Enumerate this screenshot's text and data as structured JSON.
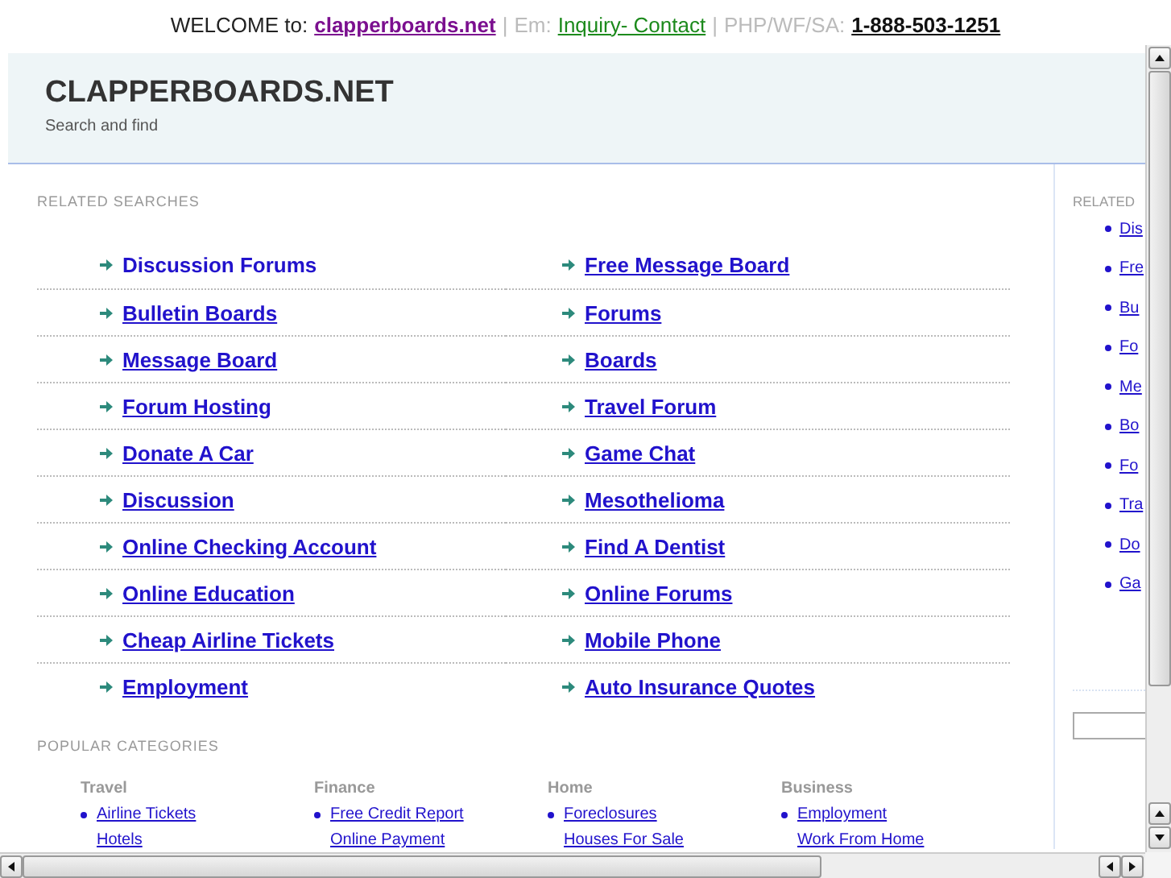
{
  "top_bar": {
    "parts": [
      {
        "kind": "label",
        "text": "WELCOME to:"
      },
      {
        "kind": "site-link",
        "text": "clapperboards.net"
      },
      {
        "kind": "divider",
        "text": "|"
      },
      {
        "kind": "muted",
        "text": "Em:"
      },
      {
        "kind": "contact-link",
        "text": "Inquiry- Contact"
      },
      {
        "kind": "divider",
        "text": "|"
      },
      {
        "kind": "muted",
        "text": "PHP/WF/SA:"
      },
      {
        "kind": "phone",
        "text": "1-888-503-1251"
      }
    ]
  },
  "header": {
    "title": "CLAPPERBOARDS.NET",
    "subtitle": "Search and find"
  },
  "related": {
    "heading": "RELATED SEARCHES",
    "links": [
      {
        "label": "Discussion Forums",
        "hovered": true
      },
      {
        "label": "Free Message Board",
        "hovered": false
      },
      {
        "label": "Bulletin Boards",
        "hovered": false
      },
      {
        "label": "Forums",
        "hovered": false
      },
      {
        "label": "Message Board",
        "hovered": false
      },
      {
        "label": "Boards",
        "hovered": false
      },
      {
        "label": "Forum Hosting",
        "hovered": false
      },
      {
        "label": "Travel Forum",
        "hovered": false
      },
      {
        "label": "Donate A Car",
        "hovered": false
      },
      {
        "label": "Game Chat",
        "hovered": false
      },
      {
        "label": "Discussion",
        "hovered": false
      },
      {
        "label": "Mesothelioma",
        "hovered": false
      },
      {
        "label": "Online Checking Account",
        "hovered": false
      },
      {
        "label": "Find A Dentist",
        "hovered": false
      },
      {
        "label": "Online Education",
        "hovered": false
      },
      {
        "label": "Online Forums",
        "hovered": false
      },
      {
        "label": "Cheap Airline Tickets",
        "hovered": false
      },
      {
        "label": "Mobile Phone",
        "hovered": false
      },
      {
        "label": "Employment",
        "hovered": false
      },
      {
        "label": "Auto Insurance Quotes",
        "hovered": false
      }
    ]
  },
  "sidebar": {
    "heading": "RELATED",
    "links": [
      "Dis",
      "Fre",
      "Bu",
      "Fo",
      "Me",
      "Bo",
      "Fo",
      "Tra",
      "Do",
      "Ga"
    ]
  },
  "popular": {
    "heading": "POPULAR CATEGORIES",
    "categories": [
      {
        "name": "Travel",
        "links": [
          "Airline Tickets",
          "Hotels"
        ]
      },
      {
        "name": "Finance",
        "links": [
          "Free Credit Report",
          "Online Payment"
        ]
      },
      {
        "name": "Home",
        "links": [
          "Foreclosures",
          "Houses For Sale"
        ]
      },
      {
        "name": "Business",
        "links": [
          "Employment",
          "Work From Home"
        ]
      }
    ]
  }
}
